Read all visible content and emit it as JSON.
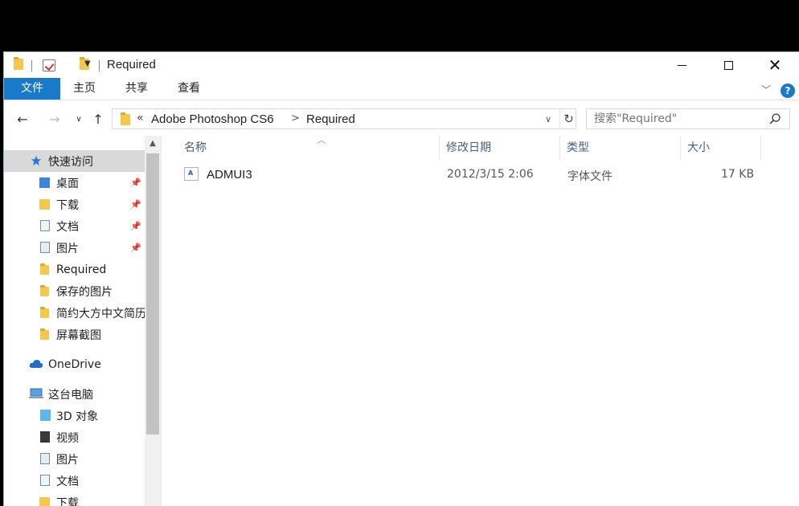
{
  "window": {
    "title": "Required"
  },
  "ribbon": {
    "tabs": [
      {
        "label": "文件"
      },
      {
        "label": "主页"
      },
      {
        "label": "共享"
      },
      {
        "label": "查看"
      }
    ],
    "accent": "#1979ca"
  },
  "address": {
    "prefix": "«",
    "segments": [
      "Adobe Photoshop CS6",
      "Required"
    ]
  },
  "search": {
    "placeholder": "搜索\"Required\""
  },
  "nav_pane": {
    "quick_access": "快速访问",
    "quick_items": [
      {
        "label": "桌面",
        "pinned": true
      },
      {
        "label": "下载",
        "pinned": true
      },
      {
        "label": "文档",
        "pinned": true
      },
      {
        "label": "图片",
        "pinned": true
      },
      {
        "label": "Required",
        "pinned": false
      },
      {
        "label": "保存的图片",
        "pinned": false
      },
      {
        "label": "简约大方中文简历",
        "pinned": false
      },
      {
        "label": "屏幕截图",
        "pinned": false
      }
    ],
    "onedrive": "OneDrive",
    "this_pc": "这台电脑",
    "pc_items": [
      {
        "label": "3D 对象"
      },
      {
        "label": "视频"
      },
      {
        "label": "图片"
      },
      {
        "label": "文档"
      },
      {
        "label": "下载"
      }
    ]
  },
  "columns": {
    "name": "名称",
    "modified": "修改日期",
    "type": "类型",
    "size": "大小"
  },
  "files": [
    {
      "name": "ADMUI3",
      "modified": "2012/3/15 2:06",
      "type": "字体文件",
      "size": "17 KB"
    }
  ]
}
